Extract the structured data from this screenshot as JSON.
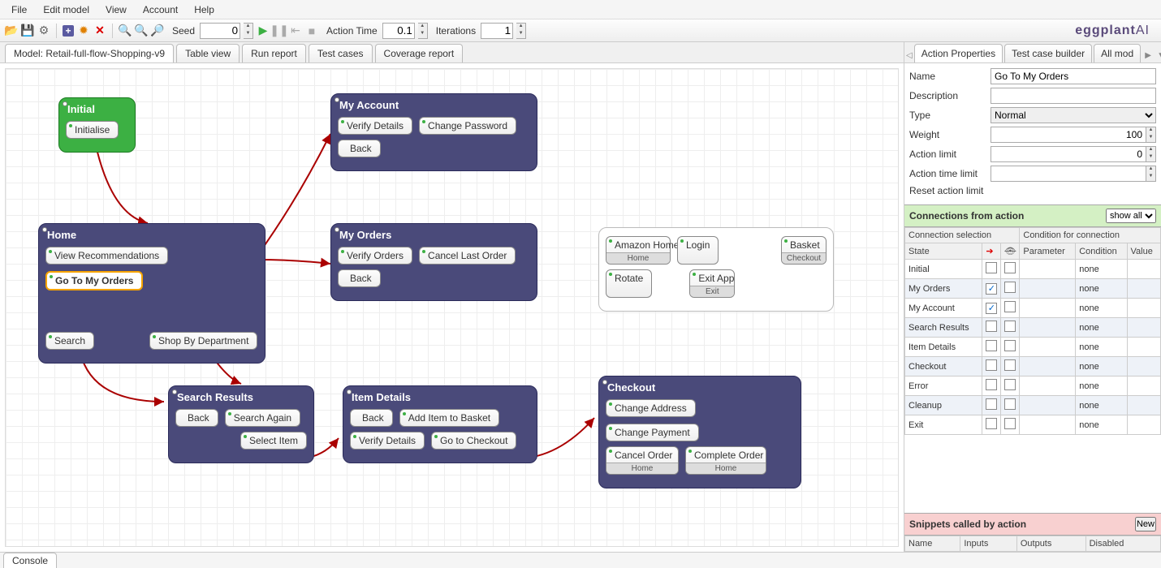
{
  "menu": [
    "File",
    "Edit model",
    "View",
    "Account",
    "Help"
  ],
  "toolbar": {
    "seed_label": "Seed",
    "seed": "0",
    "action_time_label": "Action Time",
    "action_time": "0.1",
    "iterations_label": "Iterations",
    "iterations": "1"
  },
  "brand": {
    "pre": "eggplant",
    "post": "AI"
  },
  "left_tabs": [
    "Model: Retail-full-flow-Shopping-v9",
    "Table view",
    "Run report",
    "Test cases",
    "Coverage report"
  ],
  "states": {
    "initial": {
      "title": "Initial",
      "acts": [
        "Initialise"
      ]
    },
    "home": {
      "title": "Home",
      "acts": [
        "View Recommendations",
        "Go To My Orders",
        "Search",
        "Shop By Department"
      ]
    },
    "myaccount": {
      "title": "My Account",
      "acts": [
        "Verify Details",
        "Change Password",
        "Back"
      ]
    },
    "myorders": {
      "title": "My Orders",
      "acts": [
        "Verify Orders",
        "Cancel Last Order",
        "Back"
      ]
    },
    "search": {
      "title": "Search Results",
      "acts": [
        "Back",
        "Search Again",
        "Select Item"
      ]
    },
    "item": {
      "title": "Item Details",
      "acts": [
        "Back",
        "Add Item to Basket",
        "Verify Details",
        "Go to Checkout"
      ]
    },
    "checkout": {
      "title": "Checkout",
      "acts": [
        "Change Address",
        "Change Payment",
        "Cancel Order",
        "Complete Order"
      ]
    },
    "misc": {
      "acts": [
        {
          "label": "Amazon Home",
          "sub": "Home"
        },
        {
          "label": "Login"
        },
        {
          "label": "Basket",
          "sub": "Checkout"
        },
        {
          "label": "Rotate"
        },
        {
          "label": "Exit App",
          "sub": "Exit"
        }
      ]
    }
  },
  "home_sub": "Home",
  "right_tabs": [
    "Action Properties",
    "Test case builder",
    "All mod"
  ],
  "props": {
    "name_l": "Name",
    "name": "Go To My Orders",
    "desc_l": "Description",
    "desc": "",
    "type_l": "Type",
    "type": "Normal",
    "weight_l": "Weight",
    "weight": "100",
    "alimit_l": "Action limit",
    "alimit": "0",
    "atlimit_l": "Action time limit",
    "atlimit": "",
    "reset_l": "Reset action limit",
    "reset": true
  },
  "conn": {
    "title": "Connections from action",
    "filter": "show all",
    "headers": [
      "State",
      "",
      "",
      "Parameter",
      "Condition",
      "Value"
    ],
    "subheaders": [
      "Connection selection",
      "Condition for connection"
    ],
    "rows": [
      {
        "state": "Initial",
        "arrow": false,
        "eye": false,
        "cond": "none"
      },
      {
        "state": "My Orders",
        "arrow": true,
        "eye": false,
        "cond": "none"
      },
      {
        "state": "My Account",
        "arrow": true,
        "eye": false,
        "cond": "none"
      },
      {
        "state": "Search Results",
        "arrow": false,
        "eye": false,
        "cond": "none"
      },
      {
        "state": "Item Details",
        "arrow": false,
        "eye": false,
        "cond": "none"
      },
      {
        "state": "Checkout",
        "arrow": false,
        "eye": false,
        "cond": "none"
      },
      {
        "state": "Error",
        "arrow": false,
        "eye": false,
        "cond": "none"
      },
      {
        "state": "Cleanup",
        "arrow": false,
        "eye": false,
        "cond": "none"
      },
      {
        "state": "Exit",
        "arrow": false,
        "eye": false,
        "cond": "none"
      }
    ]
  },
  "snip": {
    "title": "Snippets called by action",
    "btn": "New",
    "headers": [
      "Name",
      "Inputs",
      "Outputs",
      "Disabled"
    ]
  },
  "console": "Console"
}
